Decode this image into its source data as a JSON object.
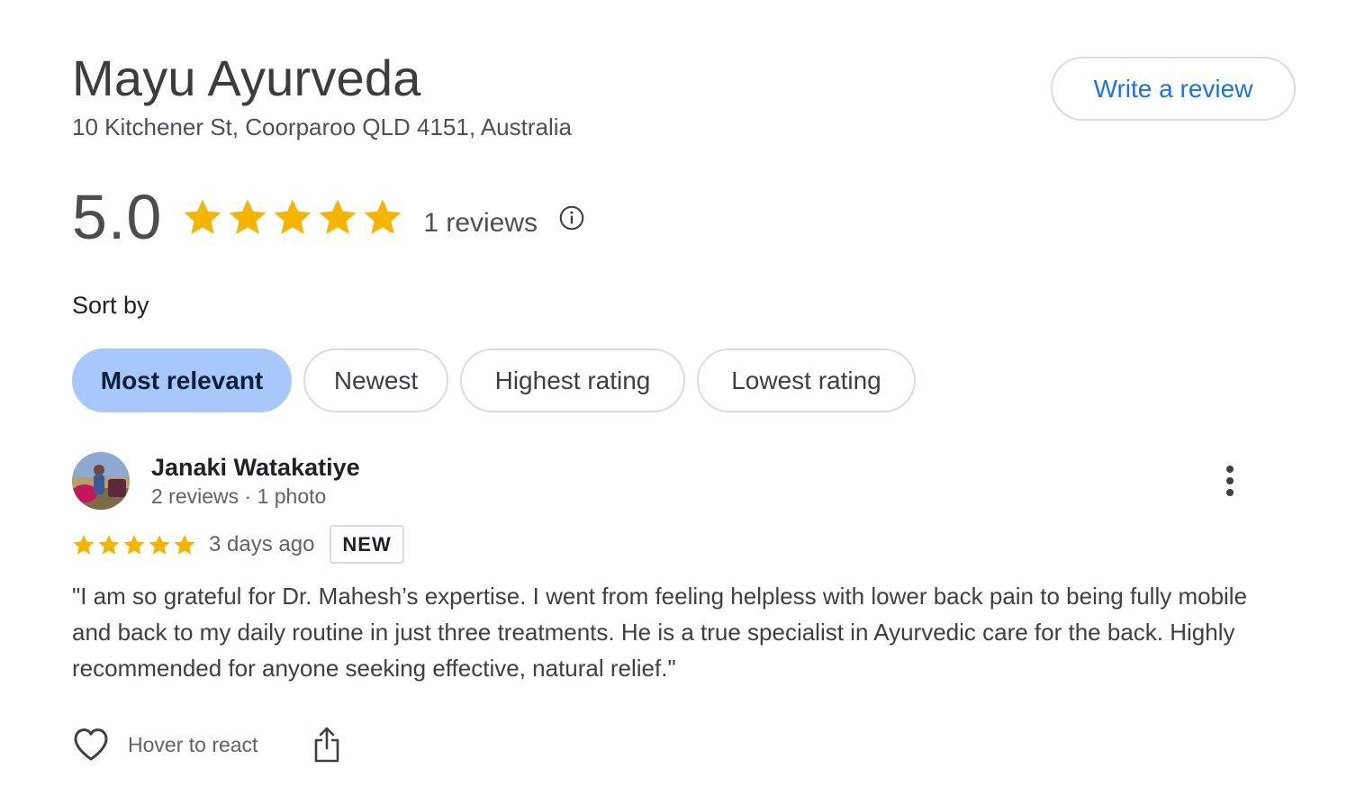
{
  "place": {
    "name": "Mayu Ayurveda",
    "address": "10 Kitchener St, Coorparoo QLD 4151, Australia"
  },
  "write_review_label": "Write a review",
  "summary": {
    "score": "5.0",
    "stars": 5,
    "count_text": "1 reviews"
  },
  "sort": {
    "label": "Sort by",
    "options": [
      {
        "label": "Most relevant",
        "selected": true
      },
      {
        "label": "Newest",
        "selected": false
      },
      {
        "label": "Highest rating",
        "selected": false
      },
      {
        "label": "Lowest rating",
        "selected": false
      }
    ]
  },
  "review": {
    "author": "Janaki Watakatiye",
    "meta": "2 reviews · 1 photo",
    "stars": 5,
    "date": "3 days ago",
    "badge": "NEW",
    "text": "\"I am so grateful for Dr. Mahesh’s expertise. I went from feeling helpless with lower back pain to being fully mobile and back to my daily routine in just three treatments. He is a true specialist in Ayurvedic care for the back. Highly recommended for anyone seeking effective, natural relief.\"",
    "react_label": "Hover to react"
  },
  "colors": {
    "star": "#f4b400",
    "link": "#1a73e8",
    "chip_selected": "#a8c7fa",
    "border": "#dadce0"
  },
  "icons": {
    "info": "info-icon",
    "more": "more-vert-icon",
    "react": "heart-outline-icon",
    "share": "share-icon"
  }
}
